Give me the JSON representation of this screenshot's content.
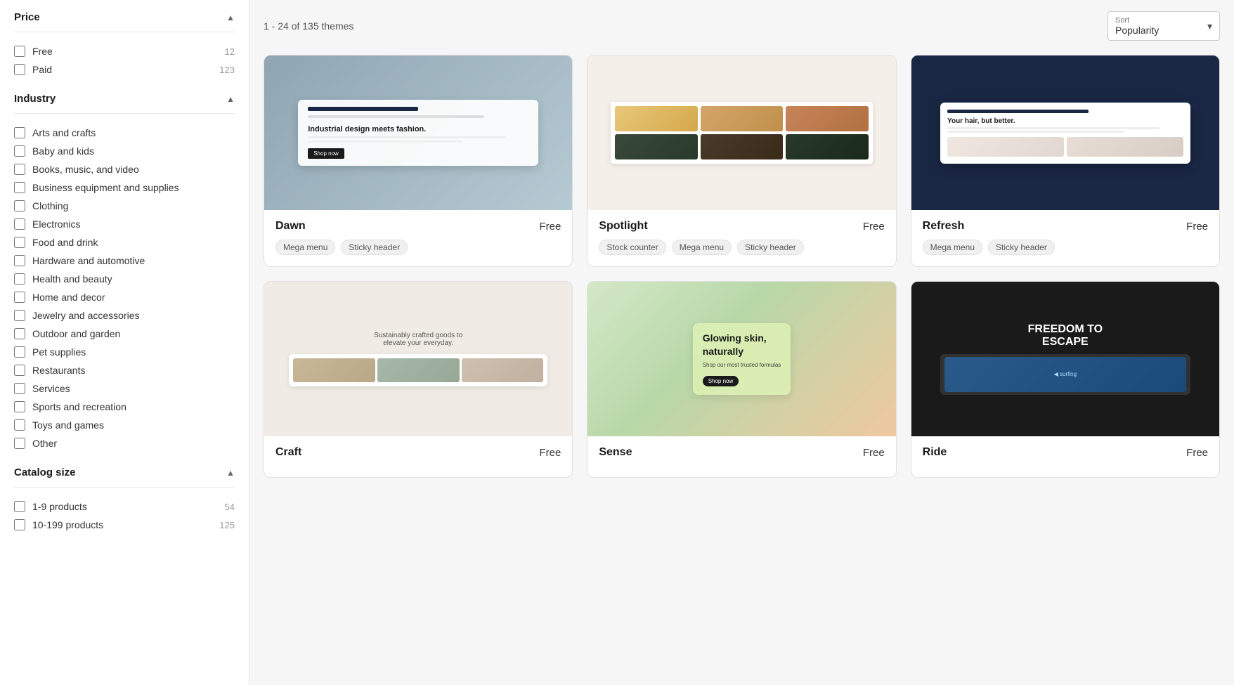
{
  "sidebar": {
    "price_section": {
      "title": "Price",
      "options": [
        {
          "label": "Free",
          "count": "12",
          "checked": false
        },
        {
          "label": "Paid",
          "count": "123",
          "checked": false
        }
      ]
    },
    "industry_section": {
      "title": "Industry",
      "options": [
        {
          "label": "Arts and crafts",
          "count": "",
          "checked": false
        },
        {
          "label": "Baby and kids",
          "count": "",
          "checked": false
        },
        {
          "label": "Books, music, and video",
          "count": "",
          "checked": false
        },
        {
          "label": "Business equipment and supplies",
          "count": "",
          "checked": false
        },
        {
          "label": "Clothing",
          "count": "",
          "checked": false
        },
        {
          "label": "Electronics",
          "count": "",
          "checked": false
        },
        {
          "label": "Food and drink",
          "count": "",
          "checked": false
        },
        {
          "label": "Hardware and automotive",
          "count": "",
          "checked": false
        },
        {
          "label": "Health and beauty",
          "count": "",
          "checked": false
        },
        {
          "label": "Home and decor",
          "count": "",
          "checked": false
        },
        {
          "label": "Jewelry and accessories",
          "count": "",
          "checked": false
        },
        {
          "label": "Outdoor and garden",
          "count": "",
          "checked": false
        },
        {
          "label": "Pet supplies",
          "count": "",
          "checked": false
        },
        {
          "label": "Restaurants",
          "count": "",
          "checked": false
        },
        {
          "label": "Services",
          "count": "",
          "checked": false
        },
        {
          "label": "Sports and recreation",
          "count": "",
          "checked": false
        },
        {
          "label": "Toys and games",
          "count": "",
          "checked": false
        },
        {
          "label": "Other",
          "count": "",
          "checked": false
        }
      ]
    },
    "catalog_section": {
      "title": "Catalog size",
      "options": [
        {
          "label": "1-9 products",
          "count": "54",
          "checked": false
        },
        {
          "label": "10-199 products",
          "count": "125",
          "checked": false
        }
      ]
    }
  },
  "header": {
    "results_count": "1 - 24 of 135 themes",
    "sort_label": "Sort",
    "sort_value": "Popularity"
  },
  "themes": [
    {
      "id": "dawn",
      "name": "Dawn",
      "price": "Free",
      "bg_class": "dawn-bg",
      "tags": [
        "Mega menu",
        "Sticky header"
      ]
    },
    {
      "id": "spotlight",
      "name": "Spotlight",
      "price": "Free",
      "bg_class": "spotlight-bg",
      "tags": [
        "Stock counter",
        "Mega menu",
        "Sticky header"
      ]
    },
    {
      "id": "refresh",
      "name": "Refresh",
      "price": "Free",
      "bg_class": "refresh-bg",
      "tags": [
        "Mega menu",
        "Sticky header"
      ]
    },
    {
      "id": "craft",
      "name": "Craft",
      "price": "Free",
      "bg_class": "craft-bg",
      "tags": []
    },
    {
      "id": "sense",
      "name": "Sense",
      "price": "Free",
      "bg_class": "sense-bg",
      "tags": []
    },
    {
      "id": "ride",
      "name": "Ride",
      "price": "Free",
      "bg_class": "ride-bg",
      "tags": []
    }
  ]
}
